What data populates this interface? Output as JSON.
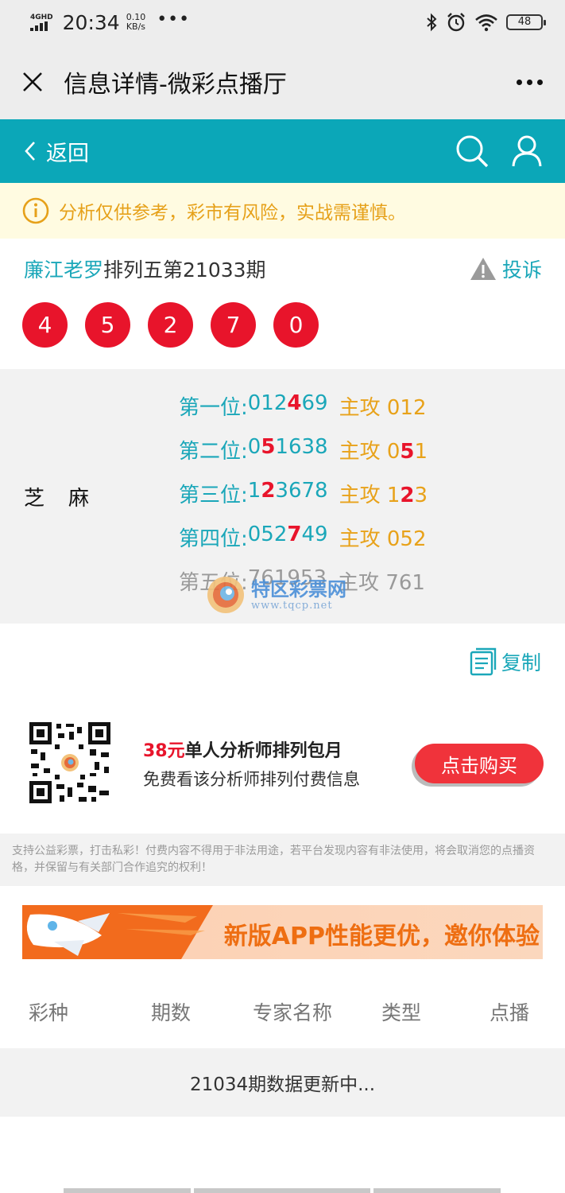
{
  "status_bar": {
    "network": "4GHD",
    "time": "20:34",
    "speed_value": "0.10",
    "speed_unit": "KB/s",
    "battery": "48"
  },
  "app_bar": {
    "title": "信息详情-微彩点播厅",
    "close_icon": "close-icon",
    "more_icon": "more-icon"
  },
  "nav": {
    "back_label": "返回",
    "search_icon": "search-icon",
    "user_icon": "user-icon",
    "bg_color": "#0ba7b8"
  },
  "notice": {
    "text": "分析仅供参考，彩市有风险，实战需谨慎。",
    "icon": "info-icon"
  },
  "expert": {
    "name": "廉江老罗",
    "issue": "排列五第21033期",
    "complain_label": "投诉"
  },
  "draw_numbers": [
    "4",
    "5",
    "2",
    "7",
    "0"
  ],
  "prediction": {
    "label": "芝麻",
    "rows": [
      {
        "position": "第一位:",
        "pre": "012",
        "hit": "4",
        "post": "69",
        "main_label": "主攻",
        "main_pre": "012",
        "main_hit": "",
        "main_post": ""
      },
      {
        "position": "第二位:",
        "pre": "0",
        "hit": "5",
        "post": "1638",
        "main_label": "主攻",
        "main_pre": "0",
        "main_hit": "5",
        "main_post": "1"
      },
      {
        "position": "第三位:",
        "pre": "1",
        "hit": "2",
        "post": "3678",
        "main_label": "主攻",
        "main_pre": "1",
        "main_hit": "2",
        "main_post": "3"
      },
      {
        "position": "第四位:",
        "pre": "052",
        "hit": "7",
        "post": "49",
        "main_label": "主攻",
        "main_pre": "052",
        "main_hit": "",
        "main_post": ""
      },
      {
        "position": "第五位:",
        "pre": "761953",
        "hit": "",
        "post": "",
        "main_label": "主攻",
        "main_pre": "761",
        "main_hit": "",
        "main_post": ""
      }
    ],
    "watermark_text": "特区彩票网",
    "watermark_url": "www.tqcp.net"
  },
  "copy_label": "复制",
  "promo": {
    "price": "38元",
    "title": "单人分析师排列包月",
    "subtitle": "免费看该分析师排列付费信息",
    "buy_label": "点击购买"
  },
  "disclaimer": "支持公益彩票，打击私彩！付费内容不得用于非法用途，若平台发现内容有非法使用，将会取消您的点播资格，并保留与有关部门合作追究的权利！",
  "banner_text": "新版APP性能更优，邀你体验",
  "table": {
    "headers": [
      "彩种",
      "期数",
      "专家名称",
      "类型",
      "点播"
    ],
    "update_text": "21034期数据更新中..."
  }
}
